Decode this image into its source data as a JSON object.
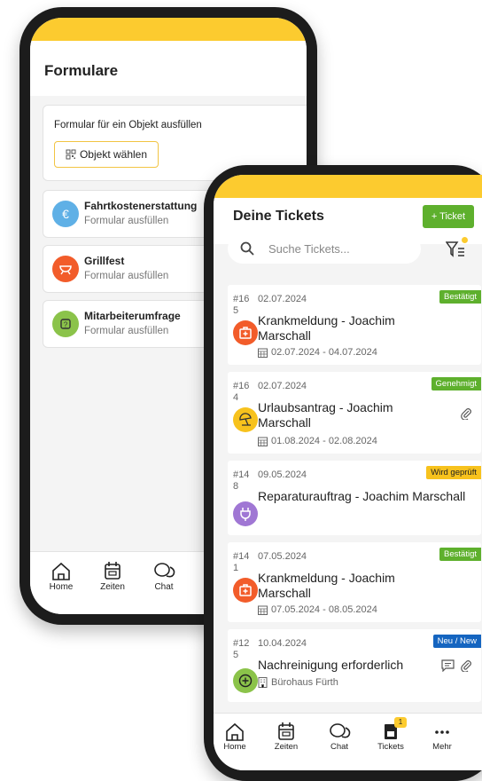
{
  "forms_screen": {
    "title": "Formulare",
    "object_card": {
      "label": "Formular für ein Objekt ausfüllen",
      "button_label": "Objekt wählen"
    },
    "forms": [
      {
        "title": "Fahrtkostenerstattung",
        "subtitle": "Formular ausfüllen",
        "icon": "euro-icon",
        "color": "#5fb0e6"
      },
      {
        "title": "Grillfest",
        "subtitle": "Formular ausfüllen",
        "icon": "grill-icon",
        "color": "#f25c2a"
      },
      {
        "title": "Mitarbeiterumfrage",
        "subtitle": "Formular ausfüllen",
        "icon": "survey-icon",
        "color": "#8bc34a"
      }
    ],
    "nav": [
      {
        "label": "Home",
        "icon": "home-icon"
      },
      {
        "label": "Zeiten",
        "icon": "calendar-icon"
      },
      {
        "label": "Chat",
        "icon": "chat-icon"
      }
    ]
  },
  "tickets_screen": {
    "title": "Deine Tickets",
    "new_ticket_label": "+ Ticket",
    "search_placeholder": "Suche Tickets...",
    "tickets": [
      {
        "number": "#16 5",
        "date": "02.07.2024",
        "status": "Bestätigt",
        "status_color": "#5eb02d",
        "title": "Krankmeldung - Joachim Marschall",
        "range": "02.07.2024 - 04.07.2024",
        "icon": "medical-icon",
        "icon_color": "#f25c2a"
      },
      {
        "number": "#16 4",
        "date": "02.07.2024",
        "status": "Genehmigt",
        "status_color": "#5eb02d",
        "title": "Urlaubsantrag - Joachim Marschall",
        "range": "01.08.2024 - 02.08.2024",
        "icon": "beach-umbrella-icon",
        "icon_color": "#f7c21d"
      },
      {
        "number": "#14 8",
        "date": "09.05.2024",
        "status": "Wird geprüft",
        "status_color": "#f7c21d",
        "title": "Reparaturauftrag - Joachim Marschall",
        "range": "",
        "icon": "plug-icon",
        "icon_color": "#a077d4"
      },
      {
        "number": "#14 1",
        "date": "07.05.2024",
        "status": "Bestätigt",
        "status_color": "#5eb02d",
        "title": "Krankmeldung - Joachim Marschall",
        "range": "07.05.2024 - 08.05.2024",
        "icon": "medical-icon",
        "icon_color": "#f25c2a"
      },
      {
        "number": "#12 5",
        "date": "10.04.2024",
        "status": "Neu / New",
        "status_color": "#1565c0",
        "title": "Nachreinigung erforderlich",
        "range": "Bürohaus Fürth",
        "icon": "plus-circle-icon",
        "icon_color": "#8bc34a"
      }
    ],
    "nav": [
      {
        "label": "Home",
        "icon": "home-icon"
      },
      {
        "label": "Zeiten",
        "icon": "calendar-icon"
      },
      {
        "label": "Chat",
        "icon": "chat-icon"
      },
      {
        "label": "Tickets",
        "icon": "ticket-icon",
        "badge": "1"
      },
      {
        "label": "Mehr",
        "icon": "more-icon"
      }
    ]
  }
}
